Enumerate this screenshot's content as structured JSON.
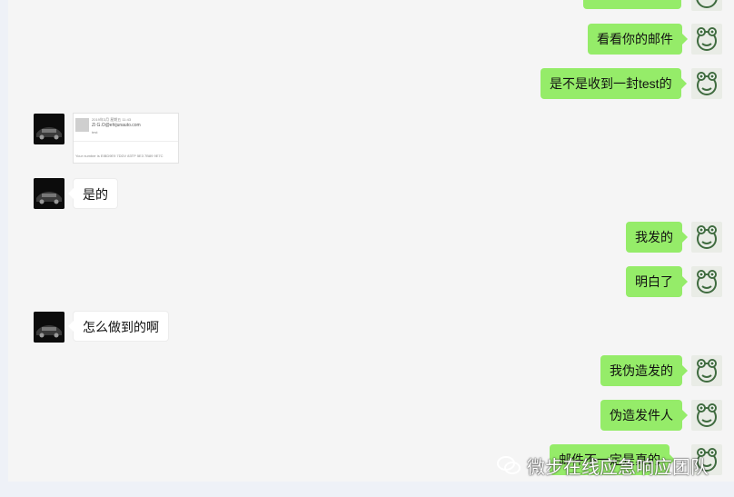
{
  "messages": [
    {
      "side": "right",
      "text": "看看你的邮件"
    },
    {
      "side": "right",
      "text": "是不是收到一封test的"
    },
    {
      "side": "left",
      "type": "image",
      "email_preview": {
        "sender": "Zi G.O@ehijunauto.com",
        "line1": "2019年3月 星期五 11:43",
        "line2": "test",
        "body": "Your number is EIBD9E9 7DDV 83TP 5E3 7B89 9E7C"
      }
    },
    {
      "side": "left",
      "text": "是的"
    },
    {
      "side": "right",
      "text": "我发的"
    },
    {
      "side": "right",
      "text": "明白了"
    },
    {
      "side": "left",
      "text": "怎么做到的啊"
    },
    {
      "side": "right",
      "text": "我伪造发的"
    },
    {
      "side": "right",
      "text": "伪造发件人"
    },
    {
      "side": "right",
      "text": "邮件不一定是真的"
    }
  ],
  "watermark": {
    "text": "微步在线应急响应团队"
  },
  "colors": {
    "bubble_green": "#95ec69",
    "bubble_white": "#ffffff",
    "chat_bg": "#f5f5f5"
  },
  "icons": {
    "user_avatar": "cartoon-frog-icon",
    "contact_avatar": "car-photo-icon",
    "watermark": "wechat-logo-icon"
  }
}
